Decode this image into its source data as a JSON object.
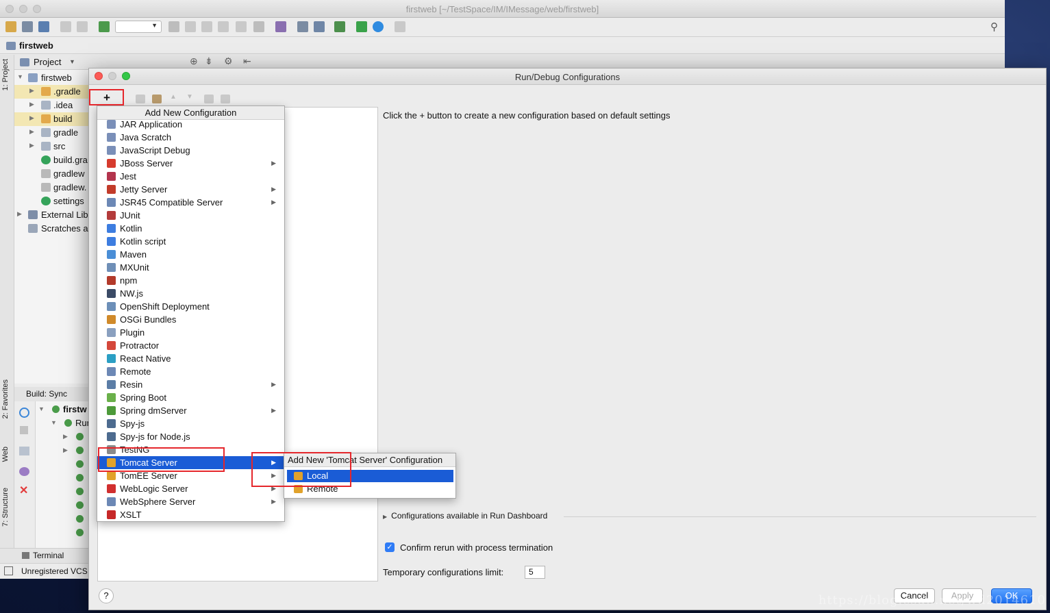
{
  "window": {
    "title": "firstweb [~/TestSpace/IM/IMessage/web/firstweb]"
  },
  "navbar": {
    "crumb": "firstweb"
  },
  "project_pane": {
    "header": "Project",
    "items": [
      {
        "label": "firstweb",
        "level": 0,
        "icon": "module-icon"
      },
      {
        "label": ".gradle",
        "level": 1,
        "icon": "folder-icon"
      },
      {
        "label": ".idea",
        "level": 1,
        "icon": "folder-icon"
      },
      {
        "label": "build",
        "level": 1,
        "icon": "folder-icon"
      },
      {
        "label": "gradle",
        "level": 1,
        "icon": "folder-icon"
      },
      {
        "label": "src",
        "level": 1,
        "icon": "folder-icon"
      },
      {
        "label": "build.gra",
        "level": 1,
        "icon": "gradle-icon"
      },
      {
        "label": "gradlew",
        "level": 1,
        "icon": "file-icon"
      },
      {
        "label": "gradlew.",
        "level": 1,
        "icon": "file-icon"
      },
      {
        "label": "settings",
        "level": 1,
        "icon": "gradle-icon"
      },
      {
        "label": "External Lib",
        "level": 0,
        "icon": "library-icon"
      },
      {
        "label": "Scratches a",
        "level": 0,
        "icon": "scratch-icon"
      }
    ]
  },
  "side_tabs": {
    "project": "1: Project",
    "favorites": "2: Favorites",
    "web": "Web",
    "structure": "7: Structure"
  },
  "build_pane": {
    "header": "Build: Sync",
    "root": "firstw",
    "run": "Run"
  },
  "bottom_tabs": {
    "terminal": "Terminal"
  },
  "statusbar": {
    "text": "Unregistered VCS r"
  },
  "dialog": {
    "title": "Run/Debug Configurations",
    "hint": "Click the + button to create a new configuration based on default settings",
    "configs_available": "Configurations available in Run Dashboard",
    "confirm_rerun": "Confirm rerun with process termination",
    "confirm_checked": true,
    "temp_limit_label": "Temporary configurations limit:",
    "temp_limit_value": "5",
    "help": "?",
    "cancel": "Cancel",
    "apply": "Apply",
    "ok": "OK",
    "plus": "+"
  },
  "menu": {
    "title": "Add New Configuration",
    "items": [
      {
        "label": "JAR Application",
        "arrow": false,
        "color": "#7a8fb8"
      },
      {
        "label": "Java Scratch",
        "arrow": false,
        "color": "#7a8fb8"
      },
      {
        "label": "JavaScript Debug",
        "arrow": false,
        "color": "#7a8fb8"
      },
      {
        "label": "JBoss Server",
        "arrow": true,
        "color": "#d63b2e"
      },
      {
        "label": "Jest",
        "arrow": false,
        "color": "#b3344d"
      },
      {
        "label": "Jetty Server",
        "arrow": true,
        "color": "#c23b2a"
      },
      {
        "label": "JSR45 Compatible Server",
        "arrow": true,
        "color": "#6c88b5"
      },
      {
        "label": "JUnit",
        "arrow": false,
        "color": "#b33b3b"
      },
      {
        "label": "Kotlin",
        "arrow": false,
        "color": "#3d7de0"
      },
      {
        "label": "Kotlin script",
        "arrow": false,
        "color": "#3d7de0"
      },
      {
        "label": "Maven",
        "arrow": false,
        "color": "#4a8ed6"
      },
      {
        "label": "MXUnit",
        "arrow": false,
        "color": "#6f8fb7"
      },
      {
        "label": "npm",
        "arrow": false,
        "color": "#b33a2a"
      },
      {
        "label": "NW.js",
        "arrow": false,
        "color": "#3b4b66"
      },
      {
        "label": "OpenShift Deployment",
        "arrow": false,
        "color": "#6c8fb8"
      },
      {
        "label": "OSGi Bundles",
        "arrow": false,
        "color": "#d08a2a"
      },
      {
        "label": "Plugin",
        "arrow": false,
        "color": "#8aa0bf"
      },
      {
        "label": "Protractor",
        "arrow": false,
        "color": "#d4473b"
      },
      {
        "label": "React Native",
        "arrow": false,
        "color": "#2b9fc4"
      },
      {
        "label": "Remote",
        "arrow": false,
        "color": "#6c88b5"
      },
      {
        "label": "Resin",
        "arrow": true,
        "color": "#5b7da6"
      },
      {
        "label": "Spring Boot",
        "arrow": false,
        "color": "#6ab04a"
      },
      {
        "label": "Spring dmServer",
        "arrow": true,
        "color": "#4d9a3a"
      },
      {
        "label": "Spy-js",
        "arrow": false,
        "color": "#4d6b8f"
      },
      {
        "label": "Spy-js for Node.js",
        "arrow": false,
        "color": "#4d6b8f"
      },
      {
        "label": "TestNG",
        "arrow": false,
        "color": "#8a8a8a"
      },
      {
        "label": "Tomcat Server",
        "arrow": true,
        "color": "#e1a22b",
        "selected": true
      },
      {
        "label": "TomEE Server",
        "arrow": true,
        "color": "#e1a22b"
      },
      {
        "label": "WebLogic Server",
        "arrow": true,
        "color": "#d12f2f"
      },
      {
        "label": "WebSphere Server",
        "arrow": true,
        "color": "#6c88b5"
      },
      {
        "label": "XSLT",
        "arrow": false,
        "color": "#c62828"
      }
    ]
  },
  "submenu": {
    "title": "Add New 'Tomcat Server' Configuration",
    "items": [
      {
        "label": "Local",
        "selected": true
      },
      {
        "label": "Remote",
        "selected": false
      }
    ]
  },
  "watermark": "https://blog.csdn.net/wd2014610"
}
